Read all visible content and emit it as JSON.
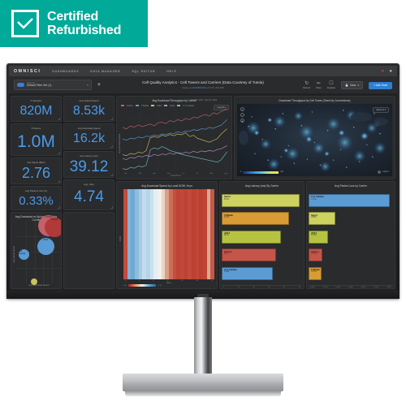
{
  "badge": {
    "line1": "Certified",
    "line2": "Refurbished",
    "icon": "check-icon",
    "color": "#00a998"
  },
  "navbar": {
    "logo": "OMNISCI",
    "links": [
      "DASHBOARDS",
      "DATA MANAGER",
      "SQL EDITOR",
      "HELP"
    ],
    "right_icons": [
      "notification-icon",
      "user-account-icon"
    ]
  },
  "subbar": {
    "filter": {
      "caption": "Filter set",
      "value": "Default Filter Set (1)",
      "chevron": "chevron-down-icon"
    },
    "funnel_icon": "funnel-icon",
    "title": "Cell Quality Analytics - Cell Towers and Carriers (Data Courtesy of Tutela)",
    "subtitle_prefix": "tutela_us",
    "subtitle_link": "DASHBOARD",
    "subtitle_suffix": "of 5,971,402,685",
    "toolbar": [
      {
        "label": "Refresh",
        "icon": "refresh-icon"
      },
      {
        "label": "Share",
        "icon": "share-icon"
      },
      {
        "label": "Duplicate",
        "icon": "duplicate-icon"
      }
    ],
    "save_label": "Save",
    "save_icon": "save-icon",
    "add_chart_label": "+ Add Chart"
  },
  "kpis_col1": [
    {
      "label": "# Samples",
      "value": "820M"
    },
    {
      "label": "# Towers",
      "value": "1.0M"
    },
    {
      "label": "Avg Signal (Bars)",
      "value": "2.76"
    },
    {
      "label": "Avg Packet Loss (%)",
      "value": "0.33%"
    }
  ],
  "kpis_col2": [
    {
      "label": "Avg Upload Speed",
      "value": "8.53k"
    },
    {
      "label": "Avg Download Speed",
      "value": "16.2k"
    },
    {
      "label": "Avg Latency (ms)",
      "value": "39.12"
    },
    {
      "label": "Avg. Jitter",
      "value": "4.74"
    }
  ],
  "accent": {
    "kpi_value": "#4a9ae8",
    "primary_button": "#2f7fd4",
    "badge_green": "#00a998"
  },
  "chart_data": [
    {
      "type": "line",
      "title": "Avg Download Throughput by Carrier",
      "xlabel": "Local Time",
      "ylabel": "Avg Download Speed",
      "date_range": "Feb 08, 2019 - Sep 01, 2019",
      "legend_label": "Legend",
      "legend_position": "top-left",
      "grid": true,
      "ylim": [
        0,
        30000
      ],
      "yticks": [
        "30k",
        "28k",
        "26k",
        "24k",
        "22k",
        "20k",
        "18k",
        "16k",
        "14k",
        "12k",
        "10k",
        "8k",
        "6k",
        "4k"
      ],
      "xticks": [
        "Feb",
        "Mar",
        "Apr",
        "May",
        "Jun",
        "Jul",
        "Aug",
        "Sep"
      ],
      "series": [
        {
          "name": "Verizon",
          "color": "#c4616b",
          "values": [
            19800,
            19500,
            20100,
            19900,
            20400,
            20000,
            20300,
            20600,
            20200,
            20900,
            21000,
            20700,
            21400,
            21100,
            21600,
            21300,
            22000,
            21700,
            22300,
            22100,
            22600,
            22900,
            22500,
            23300,
            23000,
            23600,
            24600
          ]
        },
        {
          "name": "T-Mobile",
          "color": "#5a9bd4",
          "values": [
            14400,
            14200,
            14600,
            14500,
            14900,
            14700,
            15100,
            15000,
            15400,
            15200,
            15600,
            15500,
            15800,
            15700,
            16100,
            15900,
            16300,
            16200,
            16600,
            16400,
            16800,
            16700,
            17100,
            16900,
            17300,
            17600,
            18900
          ]
        },
        {
          "name": "AT&T",
          "color": "#c9c45a",
          "values": [
            10800,
            10600,
            11100,
            10900,
            11400,
            11200,
            11800,
            14700,
            15000,
            14800,
            15300,
            15100,
            15500,
            15200,
            15600,
            15400,
            15900,
            15000,
            15300,
            14600,
            14300,
            14000,
            13700,
            14100,
            14500,
            15600,
            16800
          ]
        },
        {
          "name": "Sprint",
          "color": "#b58fc4",
          "values": [
            9900,
            9700,
            10200,
            10000,
            10500,
            10300,
            10700,
            10400,
            10900,
            10600,
            11000,
            10800,
            11200,
            10900,
            11300,
            11100,
            11400,
            11200,
            11600,
            11300,
            11700,
            11500,
            11800,
            11600,
            12000,
            12200,
            12900
          ]
        },
        {
          "name": "U.S. Cellular",
          "color": "#6ec0c9",
          "values": [
            7600,
            7400,
            7900,
            7700,
            8200,
            8000,
            8400,
            11900,
            12400,
            12100,
            12700,
            12300,
            11800,
            11500,
            11200,
            10900,
            10700,
            10500,
            10300,
            10100,
            9900,
            9700,
            9500,
            9300,
            9100,
            9600,
            11500
          ]
        }
      ]
    },
    {
      "type": "scatter",
      "title": "Avg Download vs Upload Speed by Carrier",
      "xlabel": "Avg Download Speed",
      "ylabel": "Avg Upload Speed",
      "grid": true,
      "xticks": [
        "5.0k",
        "10.0k",
        "15.0k",
        "20.0k",
        "25.0k"
      ],
      "yticks": [
        "12.0k",
        "10.0k",
        "8.0k",
        "6.0k",
        "4.0k",
        "2.0k"
      ],
      "points": [
        {
          "name": "U.S. Cellular",
          "x": 5600,
          "y": 5500,
          "r": 9,
          "color": "#5a9bd4"
        },
        {
          "name": "T-Mobile",
          "x": 16800,
          "y": 10600,
          "r": 17,
          "color": "#c4616b"
        },
        {
          "name": "AT&T",
          "x": 16200,
          "y": 7600,
          "r": 14,
          "color": "#5a9bd4"
        },
        {
          "name": "Verizon",
          "x": 24100,
          "y": 10200,
          "r": 16,
          "color": "#b03a3a"
        },
        {
          "name": "Sprint",
          "x": 11900,
          "y": 2200,
          "r": 6,
          "color": "#c9c45a"
        }
      ]
    },
    {
      "type": "heatmap",
      "title": "Avg Download Speed by Local DOW, Hour",
      "xlabel": "Hour",
      "ylabel": "DOW",
      "colorscale": [
        "#b2182b",
        "#ef8a62",
        "#f7f7f7",
        "#67a9cf",
        "#2166ac"
      ],
      "legend_min": "5.6k",
      "legend_max": "21.0k",
      "yticks": [
        "Sunday",
        "Monday",
        "Tuesday",
        "Wednesday",
        "Thursday",
        "Friday",
        "Saturday"
      ],
      "xticks": [
        "0",
        "1",
        "2",
        "3",
        "4",
        "5",
        "6",
        "7",
        "8",
        "9",
        "10",
        "11",
        "12",
        "13",
        "14",
        "15",
        "16",
        "17",
        "18",
        "19",
        "20",
        "21",
        "22",
        "23"
      ],
      "rows": [
        [
          20500,
          20800,
          20600,
          20200,
          19800,
          18200,
          15400,
          11000,
          9200,
          8600,
          8200,
          7900,
          7700,
          7600,
          7500,
          7400,
          7300,
          7200,
          7100,
          7000,
          6900,
          6800,
          7500,
          9500
        ],
        [
          20600,
          20900,
          20700,
          20300,
          19900,
          18400,
          15600,
          11200,
          9400,
          8800,
          8400,
          8100,
          7900,
          7800,
          7700,
          7600,
          7500,
          7400,
          7300,
          7200,
          7100,
          7000,
          7700,
          9700
        ],
        [
          20400,
          20700,
          20500,
          20100,
          19700,
          18100,
          15300,
          10900,
          9100,
          8500,
          8100,
          7800,
          7600,
          7500,
          7400,
          7300,
          7200,
          7100,
          7000,
          6900,
          6800,
          6700,
          7400,
          9400
        ],
        [
          20300,
          20600,
          20400,
          20000,
          19600,
          18000,
          15200,
          10800,
          9000,
          8400,
          8000,
          7700,
          7500,
          7400,
          7300,
          7200,
          7100,
          7000,
          6900,
          6800,
          6700,
          6600,
          7300,
          9300
        ],
        [
          20500,
          20800,
          20600,
          20200,
          19800,
          18200,
          15400,
          11000,
          9200,
          8600,
          8200,
          7900,
          7700,
          7600,
          7500,
          7400,
          7300,
          7200,
          7100,
          7000,
          6900,
          6800,
          7500,
          9500
        ],
        [
          20200,
          20500,
          20300,
          19900,
          19500,
          17900,
          15100,
          10700,
          8900,
          8300,
          7900,
          7600,
          7400,
          7300,
          7200,
          7100,
          7000,
          6900,
          6800,
          6700,
          6600,
          6500,
          7200,
          9200
        ],
        [
          20100,
          20400,
          20200,
          19800,
          19400,
          17800,
          15000,
          10600,
          8800,
          8200,
          7800,
          7500,
          7300,
          7200,
          7100,
          7000,
          6900,
          6800,
          6700,
          6600,
          6500,
          6400,
          7100,
          9100
        ]
      ]
    },
    {
      "type": "bar",
      "orientation": "horizontal",
      "title": "Avg Latency (ms) By Carrier",
      "xlabel": "",
      "xticks": [
        "0",
        "5",
        "10",
        "15",
        "20",
        "25",
        "30",
        "35",
        "40",
        "45",
        "50"
      ],
      "categories": [
        "Sprint",
        "T-Mobile",
        "AT&T",
        "Verizon",
        "U.S. Cellular"
      ],
      "value_labels": [
        "50.12",
        "43.06",
        "38.11",
        "35.3",
        "32.98"
      ],
      "values": [
        50.12,
        43.06,
        38.11,
        35.3,
        32.98
      ],
      "colors": [
        "#cdd15f",
        "#d99b34",
        "#b6c341",
        "#c4554a",
        "#5a9bd4"
      ]
    },
    {
      "type": "bar",
      "orientation": "horizontal",
      "title": "Avg Packet Loss by Carrier",
      "xlabel": "",
      "xticks": [
        "0.00%",
        "0.20%",
        "0.40%",
        "0.60%",
        "0.80%",
        "1.00%",
        "1.20%",
        "1.40%"
      ],
      "categories": [
        "U.S. Cellular",
        "Sprint",
        "AT&T",
        "Verizon",
        "T-Mobile"
      ],
      "value_labels": [
        "1.40%",
        "0.45%",
        "0.31%",
        "0.19%",
        "0.17%"
      ],
      "values": [
        1.4,
        0.45,
        0.31,
        0.19,
        0.17
      ],
      "colors": [
        "#5a9bd4",
        "#cdd15f",
        "#b6c341",
        "#c4554a",
        "#d99b34"
      ]
    },
    {
      "type": "scatter",
      "title": "Download Throughput by Cell Tower (Sized by Connections)",
      "map": true,
      "zoom_label": "Zoom to",
      "attribution": "mapbox",
      "legend_min": "0",
      "legend_max": "40k",
      "colorscale": [
        "#1b2a5c",
        "#2b6ec4",
        "#46a8d8",
        "#7fd2c2",
        "#d7e86a",
        "#f2e44a"
      ]
    }
  ]
}
